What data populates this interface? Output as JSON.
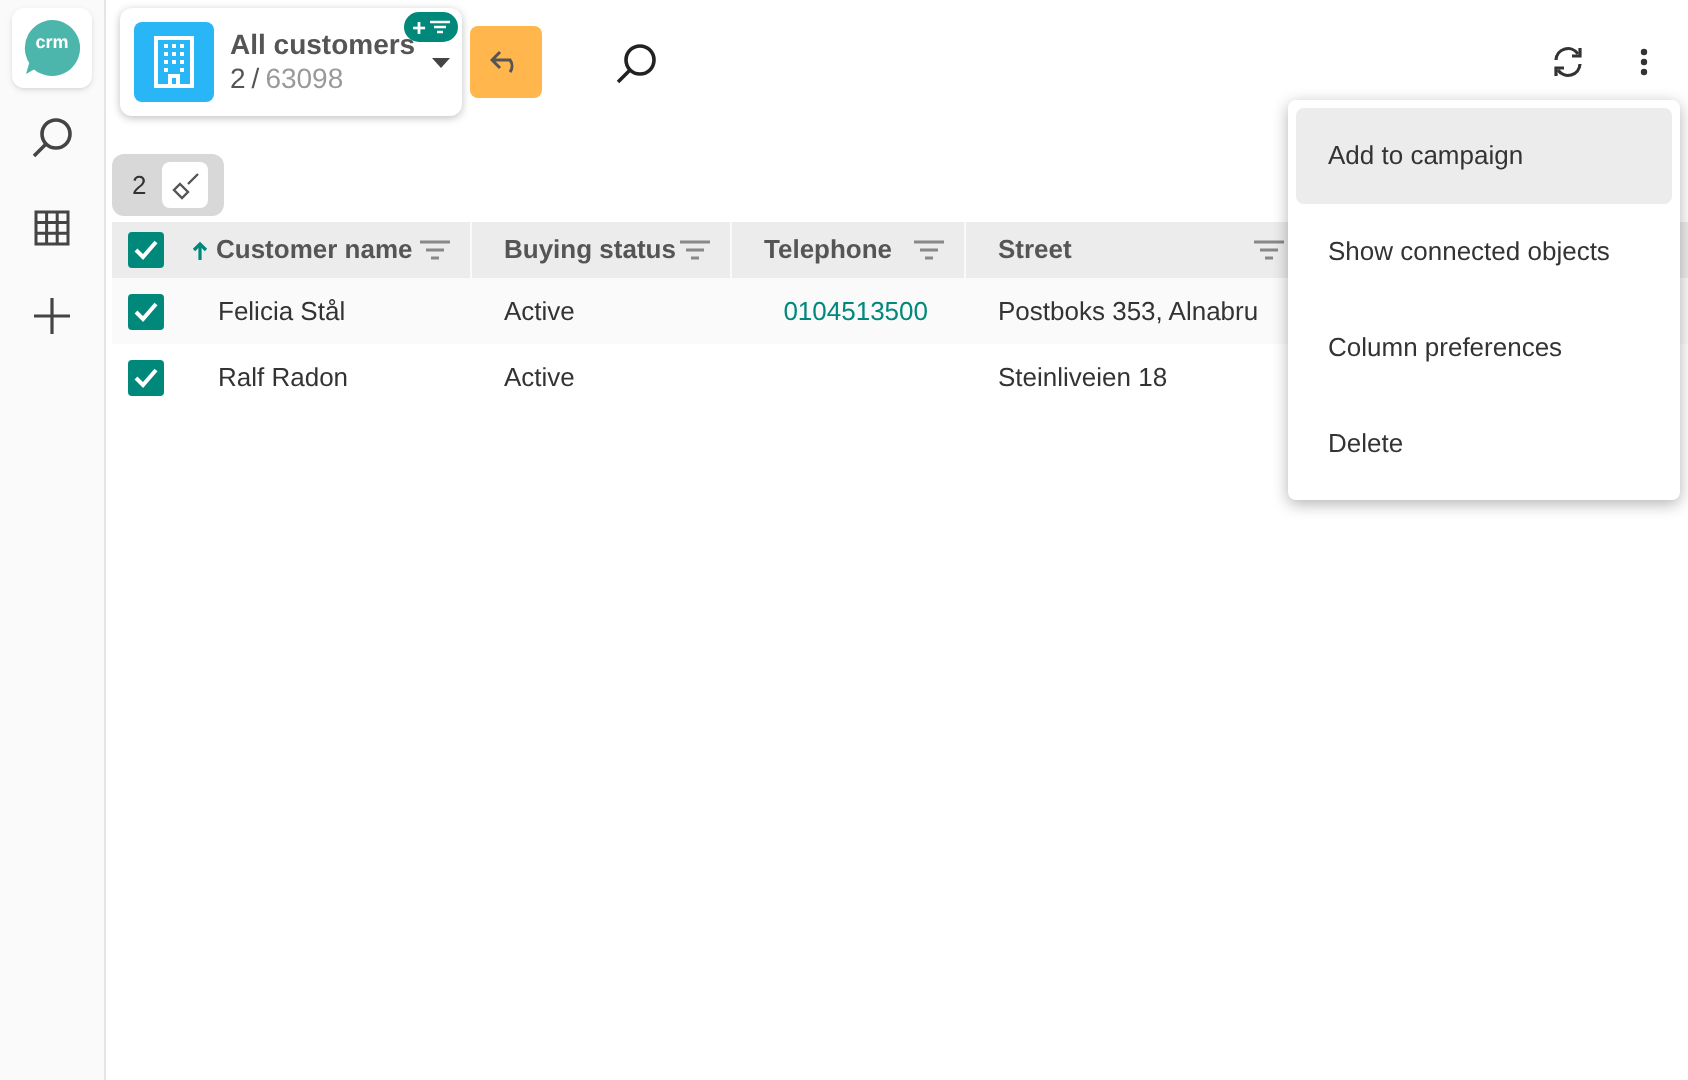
{
  "sidebar": {
    "logo": "crm"
  },
  "view": {
    "title": "All customers",
    "count": "2",
    "separator": "/",
    "total": "63098",
    "badge": "+"
  },
  "selection": {
    "count": "2"
  },
  "table": {
    "all_checked": true,
    "columns": [
      {
        "label": "Customer name",
        "sorted": true,
        "kind": "text"
      },
      {
        "label": "Buying status",
        "sorted": false,
        "kind": "text"
      },
      {
        "label": "Telephone",
        "sorted": false,
        "kind": "phone"
      },
      {
        "label": "Street",
        "sorted": false,
        "kind": "text"
      }
    ],
    "rows": [
      {
        "checked": true,
        "cells": [
          "Felicia Stål",
          "Active",
          "0104513500",
          "Postboks 353, Alnabru"
        ]
      },
      {
        "checked": true,
        "cells": [
          "Ralf Radon",
          "Active",
          "",
          "Steinliveien 18"
        ]
      }
    ]
  },
  "menu": [
    {
      "label": "Add to campaign",
      "selected": true
    },
    {
      "label": "Show connected objects",
      "selected": false
    },
    {
      "label": "Column preferences",
      "selected": false
    },
    {
      "label": "Delete",
      "selected": false
    }
  ]
}
